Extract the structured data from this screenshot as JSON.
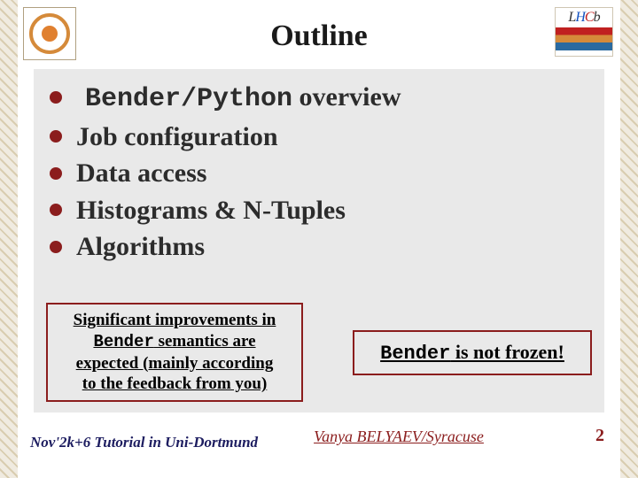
{
  "title": "Outline",
  "logo_right": {
    "text_L": "L",
    "text_H": "H",
    "text_C": "C",
    "text_b": "b"
  },
  "bullets": [
    {
      "mono": "Bender/Python",
      "rest": " overview",
      "pad": true
    },
    {
      "text": "Job configuration"
    },
    {
      "text": "Data access"
    },
    {
      "text": "Histograms & N-Tuples"
    },
    {
      "text": " Algorithms"
    }
  ],
  "box_left": {
    "l1a": "Significant improvements in",
    "l2_mono": "Bender",
    "l2_rest": " semantics are",
    "l3": "expected (mainly according",
    "l4": "to the feedback from you)"
  },
  "box_right": {
    "mono": "Bender",
    "rest": " is not frozen!"
  },
  "footer": {
    "left": "Nov'2k+6  Tutorial in Uni-Dortmund",
    "center": "Vanya  BELYAEV/Syracuse",
    "page": "2"
  }
}
